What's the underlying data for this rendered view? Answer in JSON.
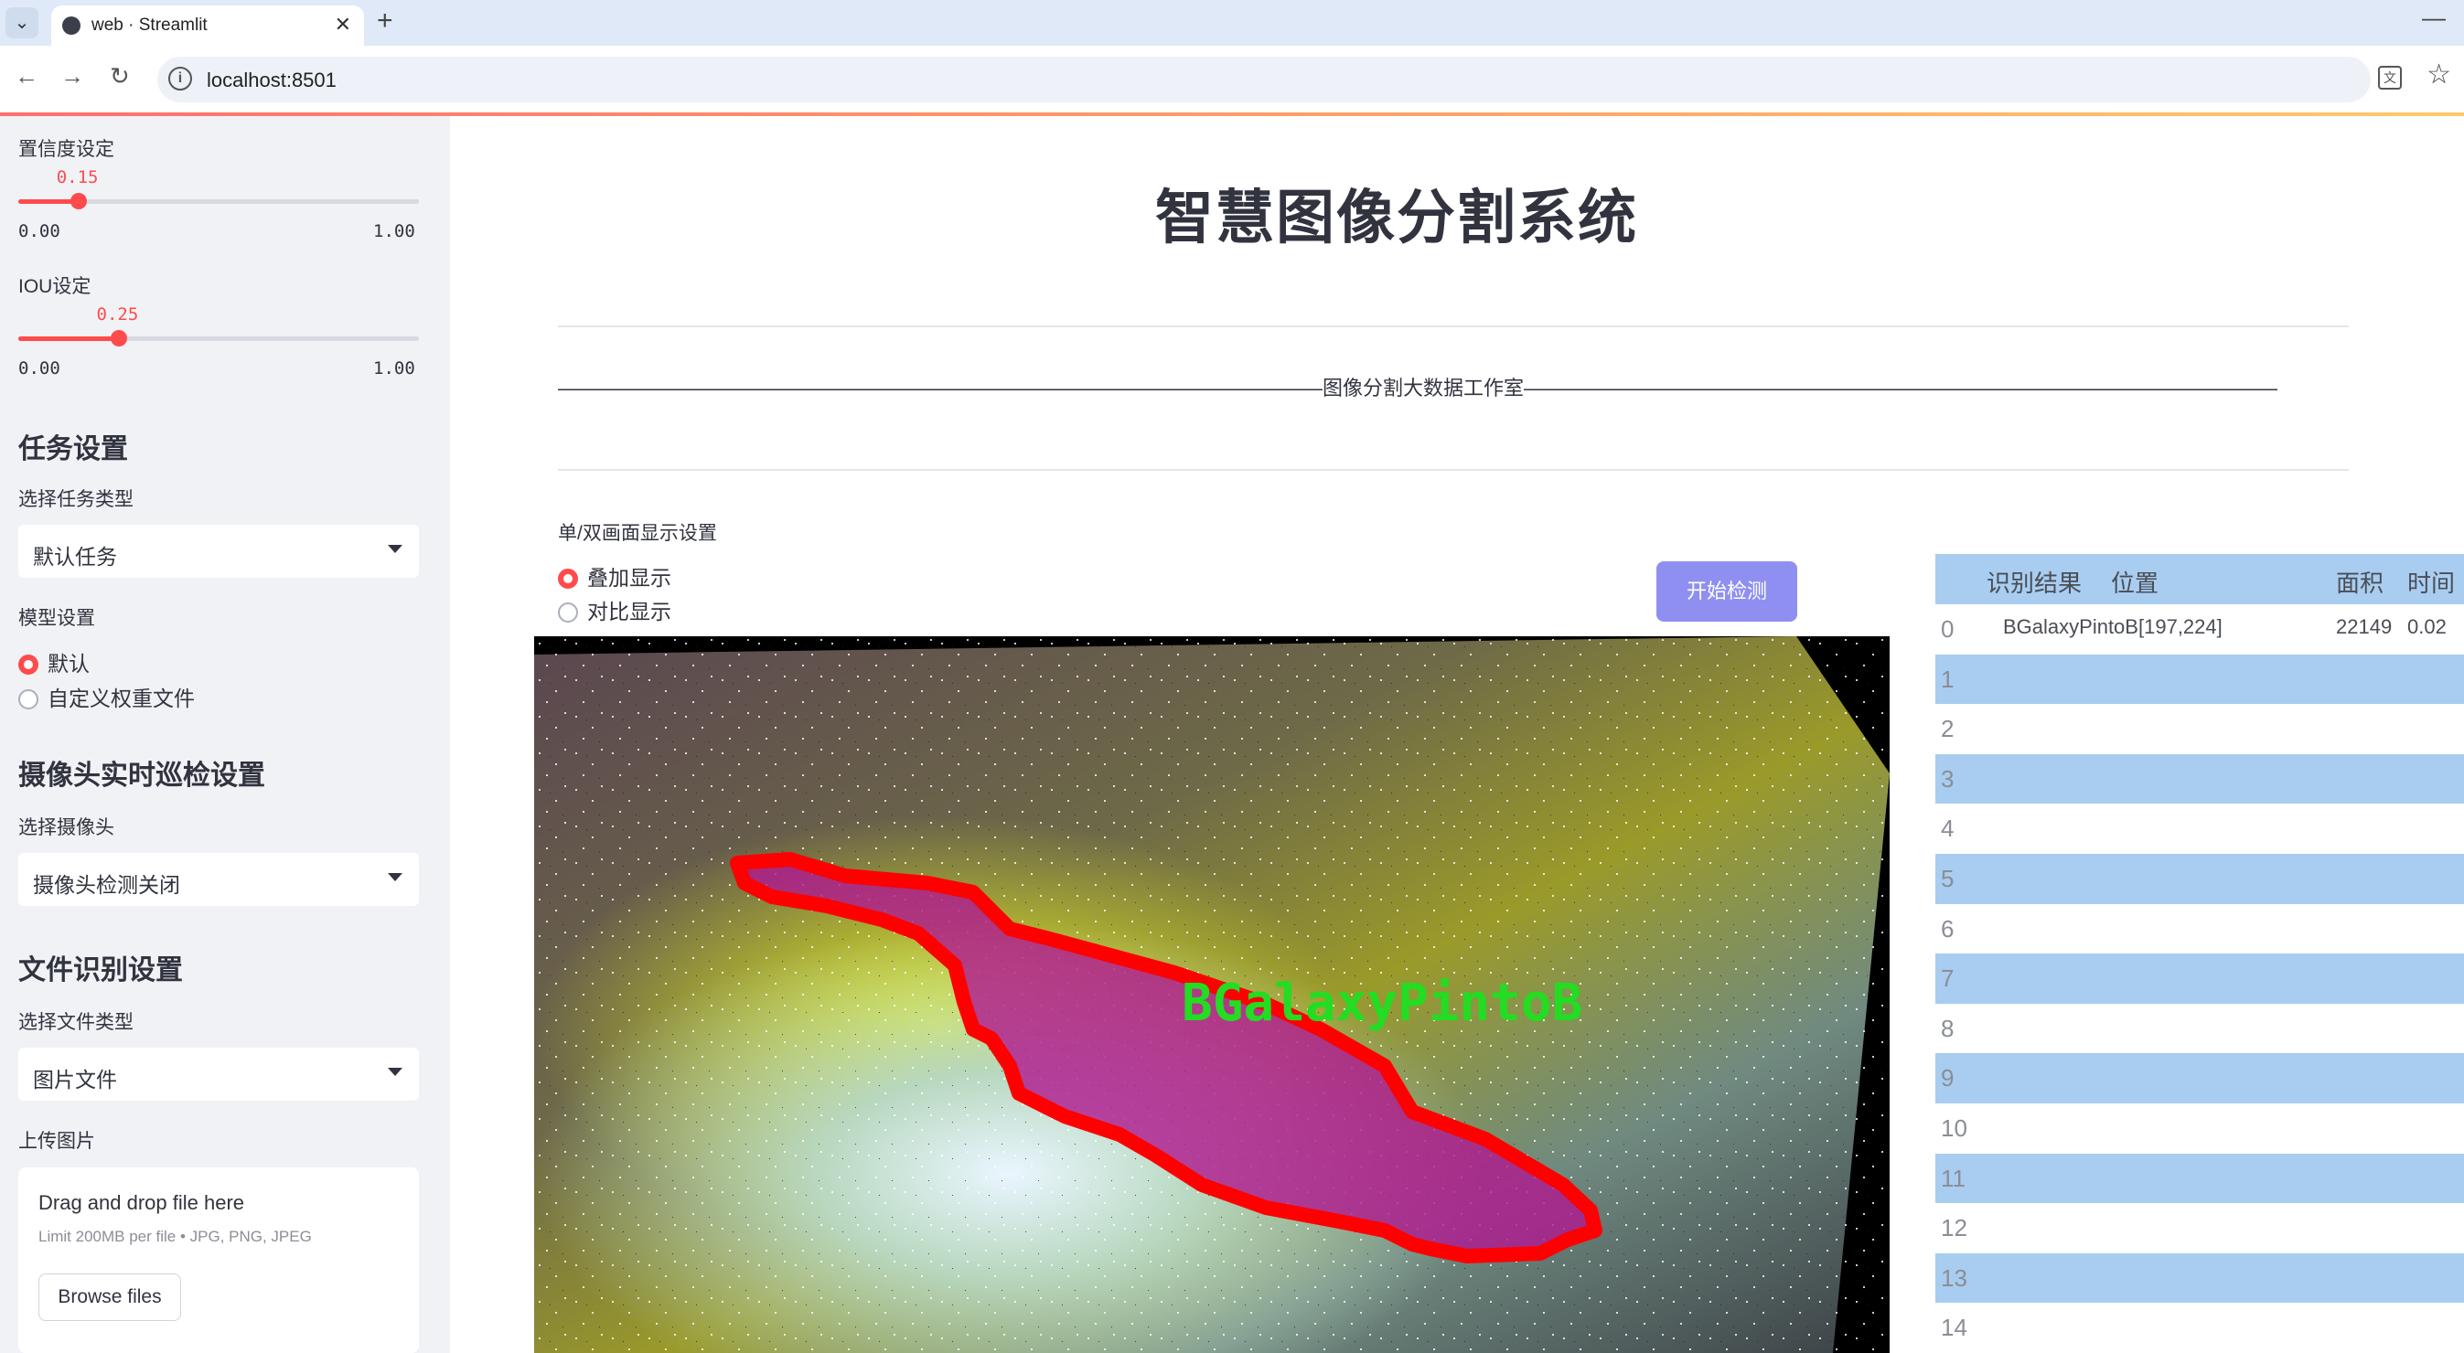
{
  "browser": {
    "tab_title": "web · Streamlit",
    "url": "localhost:8501"
  },
  "sidebar": {
    "confidence": {
      "label": "置信度设定",
      "value": "0.15",
      "min": "0.00",
      "max": "1.00",
      "fraction": 0.15
    },
    "iou": {
      "label": "IOU设定",
      "value": "0.25",
      "min": "0.00",
      "max": "1.00",
      "fraction": 0.25
    },
    "task_heading": "任务设置",
    "task_type_label": "选择任务类型",
    "task_type_value": "默认任务",
    "model_label": "模型设置",
    "model_options": [
      {
        "label": "默认",
        "selected": true
      },
      {
        "label": "自定义权重文件",
        "selected": false
      }
    ],
    "camera_heading": "摄像头实时巡检设置",
    "camera_label": "选择摄像头",
    "camera_value": "摄像头检测关闭",
    "file_heading": "文件识别设置",
    "file_type_label": "选择文件类型",
    "file_type_value": "图片文件",
    "upload_label": "上传图片",
    "dropzone": {
      "title": "Drag and drop file here",
      "limit": "Limit 200MB per file • JPG, PNG, JPEG",
      "browse": "Browse files"
    }
  },
  "main": {
    "title": "智慧图像分割系统",
    "studio_line": "——————————————————————————————————————图像分割大数据工作室——————————————————————————————————————",
    "display_label": "单/双画面显示设置",
    "display_options": [
      {
        "label": "叠加显示",
        "selected": true
      },
      {
        "label": "对比显示",
        "selected": false
      }
    ],
    "start_button": "开始检测",
    "detection_label": "BGalaxyPintoB"
  },
  "table": {
    "headers": [
      "识别结果",
      "位置",
      "面积",
      "时间"
    ],
    "rows": [
      {
        "index": "0",
        "result": "BGalaxyPintoB",
        "position": "[197,224]",
        "area": "22149",
        "time": "0.02"
      },
      {
        "index": "1"
      },
      {
        "index": "2"
      },
      {
        "index": "3"
      },
      {
        "index": "4"
      },
      {
        "index": "5"
      },
      {
        "index": "6"
      },
      {
        "index": "7"
      },
      {
        "index": "8"
      },
      {
        "index": "9"
      },
      {
        "index": "10"
      },
      {
        "index": "11"
      },
      {
        "index": "12"
      },
      {
        "index": "13"
      },
      {
        "index": "14"
      }
    ]
  },
  "colors": {
    "accent": "#ff4b4b",
    "button": "#8f8ff2",
    "table_header": "#a8cdf0",
    "mask_outline": "#ff0000",
    "label_green": "#22dd22"
  }
}
